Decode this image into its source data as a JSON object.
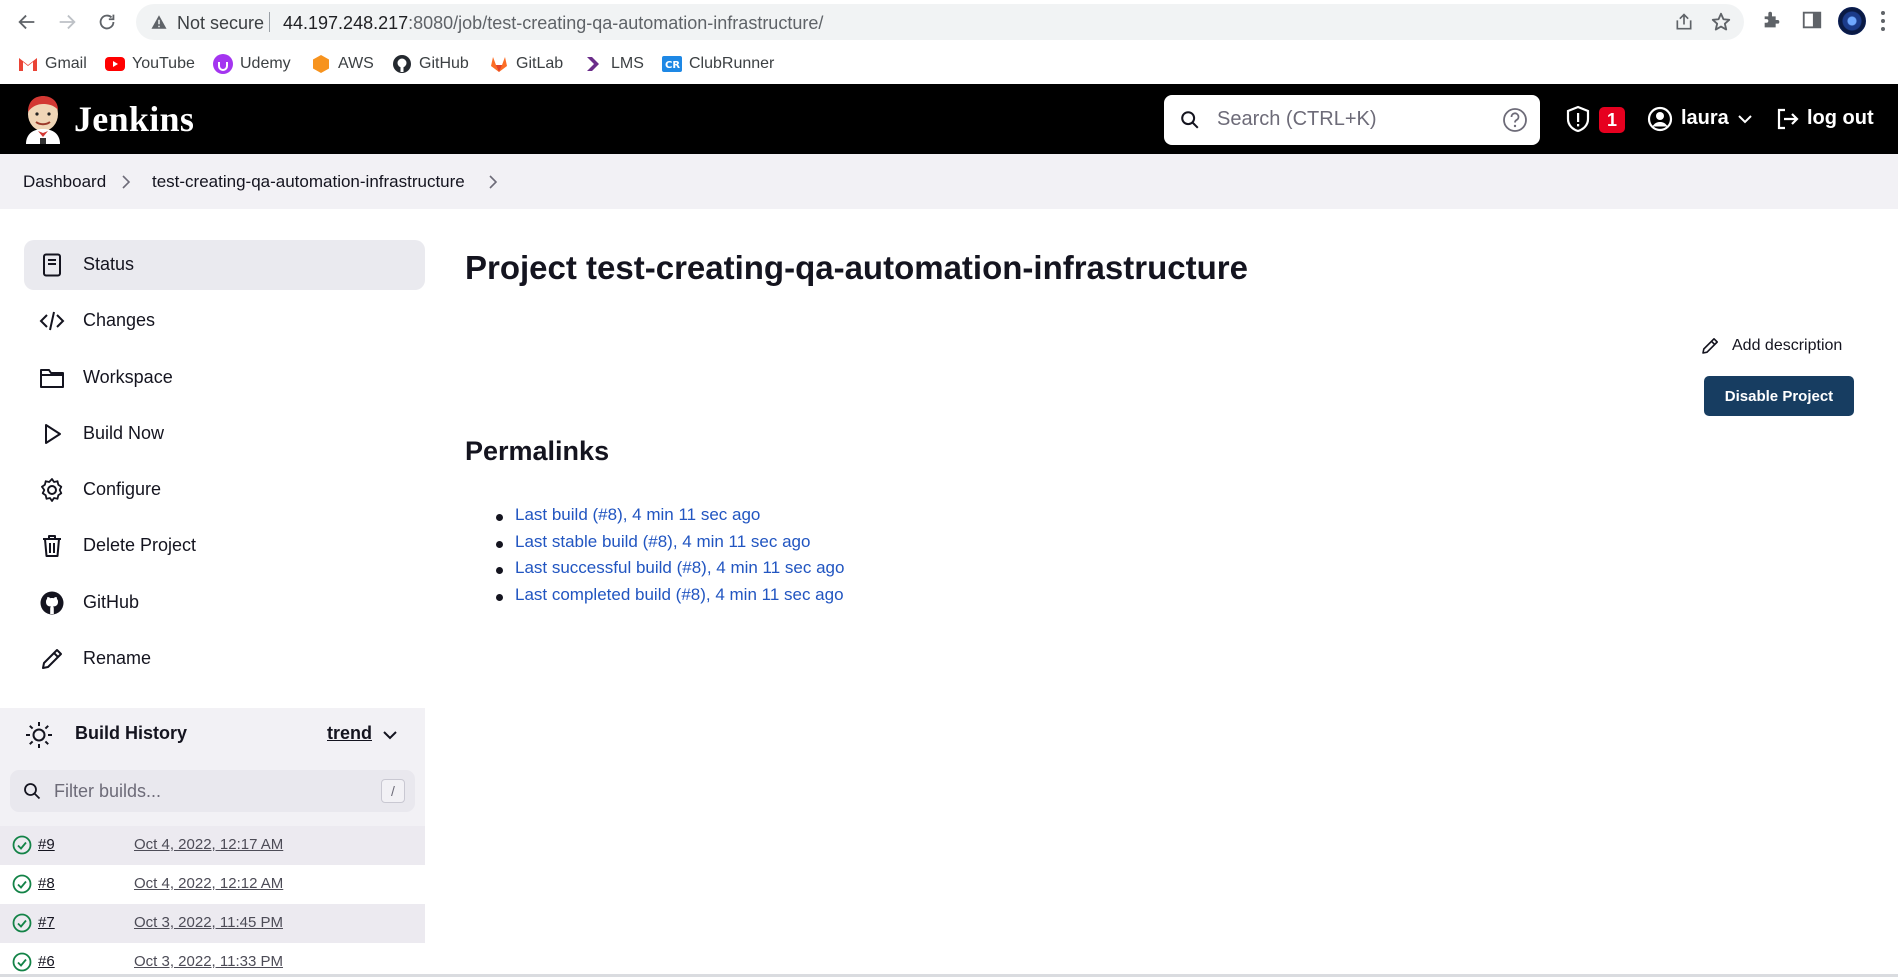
{
  "browser": {
    "security_label": "Not secure",
    "url_host": "44.197.248.217",
    "url_rest": ":8080/job/test-creating-qa-automation-infrastructure/",
    "bookmarks": [
      {
        "label": "Gmail",
        "icon": "gmail-icon",
        "color": "#ea4335"
      },
      {
        "label": "YouTube",
        "icon": "youtube-icon",
        "color": "#ff0000"
      },
      {
        "label": "Udemy",
        "icon": "udemy-icon",
        "color": "#a435f0"
      },
      {
        "label": "AWS",
        "icon": "aws-icon",
        "color": "#f7931e"
      },
      {
        "label": "GitHub",
        "icon": "github-icon",
        "color": "#24292f"
      },
      {
        "label": "GitLab",
        "icon": "gitlab-icon",
        "color": "#fc6d26"
      },
      {
        "label": "LMS",
        "icon": "lms-icon",
        "color": "#6b2d8a"
      },
      {
        "label": "ClubRunner",
        "icon": "clubrunner-icon",
        "color": "#1e88e5"
      }
    ]
  },
  "header": {
    "app_name": "Jenkins",
    "search_placeholder": "Search (CTRL+K)",
    "security_count": "1",
    "user": "laura",
    "logout_label": "log out",
    "background": "#000000",
    "badge_color": "#e6001f"
  },
  "breadcrumb": {
    "items": [
      "Dashboard",
      "test-creating-qa-automation-infrastructure"
    ]
  },
  "sidebar": {
    "items": [
      {
        "label": "Status",
        "icon": "notepad-icon",
        "active": true
      },
      {
        "label": "Changes",
        "icon": "code-icon"
      },
      {
        "label": "Workspace",
        "icon": "folder-icon"
      },
      {
        "label": "Build Now",
        "icon": "play-icon"
      },
      {
        "label": "Configure",
        "icon": "gear-icon"
      },
      {
        "label": "Delete Project",
        "icon": "trash-icon"
      },
      {
        "label": "GitHub",
        "icon": "github-icon"
      },
      {
        "label": "Rename",
        "icon": "pencil-icon"
      }
    ]
  },
  "build_history": {
    "title": "Build History",
    "trend_label": "trend",
    "filter_placeholder": "Filter builds...",
    "filter_shortcut": "/",
    "builds": [
      {
        "number": "#9",
        "date": "Oct 4, 2022, 12:17 AM",
        "status": "success"
      },
      {
        "number": "#8",
        "date": "Oct 4, 2022, 12:12 AM",
        "status": "success"
      },
      {
        "number": "#7",
        "date": "Oct 3, 2022, 11:45 PM",
        "status": "success"
      },
      {
        "number": "#6",
        "date": "Oct 3, 2022, 11:33 PM",
        "status": "success"
      }
    ],
    "success_color": "#138347"
  },
  "main": {
    "title": "Project test-creating-qa-automation-infrastructure",
    "add_description_label": "Add description",
    "disable_button_label": "Disable Project",
    "disable_button_color": "#173d61",
    "permalinks_title": "Permalinks",
    "permalinks": [
      "Last build (#8), 4 min 11 sec ago",
      "Last stable build (#8), 4 min 11 sec ago",
      "Last successful build (#8), 4 min 11 sec ago",
      "Last completed build (#8), 4 min 11 sec ago"
    ],
    "link_color": "#2155c1"
  }
}
